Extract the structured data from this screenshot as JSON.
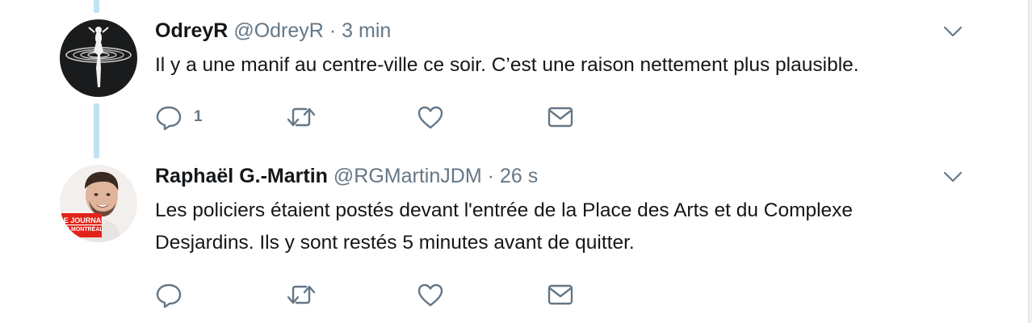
{
  "tweets": [
    {
      "name": "OdreyR",
      "handle": "@OdreyR",
      "separator": "·",
      "time": "3 min",
      "text": "Il y a une manif au centre-ville ce soir. C’est une raison nettement plus plausible.",
      "reply_count": "1",
      "icons": [
        "reply-icon",
        "retweet-icon",
        "like-icon",
        "message-icon",
        "chevron-down-icon"
      ]
    },
    {
      "name": "Raphaël G.-Martin",
      "handle": "@RGMartinJDM",
      "separator": "·",
      "time": "26 s",
      "text_line1": "Les policiers étaient postés devant l'entrée de la Place des Arts et du Complexe",
      "text_line2": "Desjardins. Ils y sont restés 5 minutes avant de quitter.",
      "avatar_badge": [
        "LE JOURNAL",
        "DE MONTRÉAL"
      ],
      "icons": [
        "reply-icon",
        "retweet-icon",
        "like-icon",
        "message-icon",
        "chevron-down-icon"
      ]
    }
  ],
  "colors": {
    "thread_line": "#bfe3f5",
    "text_primary": "#14171a",
    "text_secondary": "#657786",
    "badge_red": "#e2231a"
  }
}
